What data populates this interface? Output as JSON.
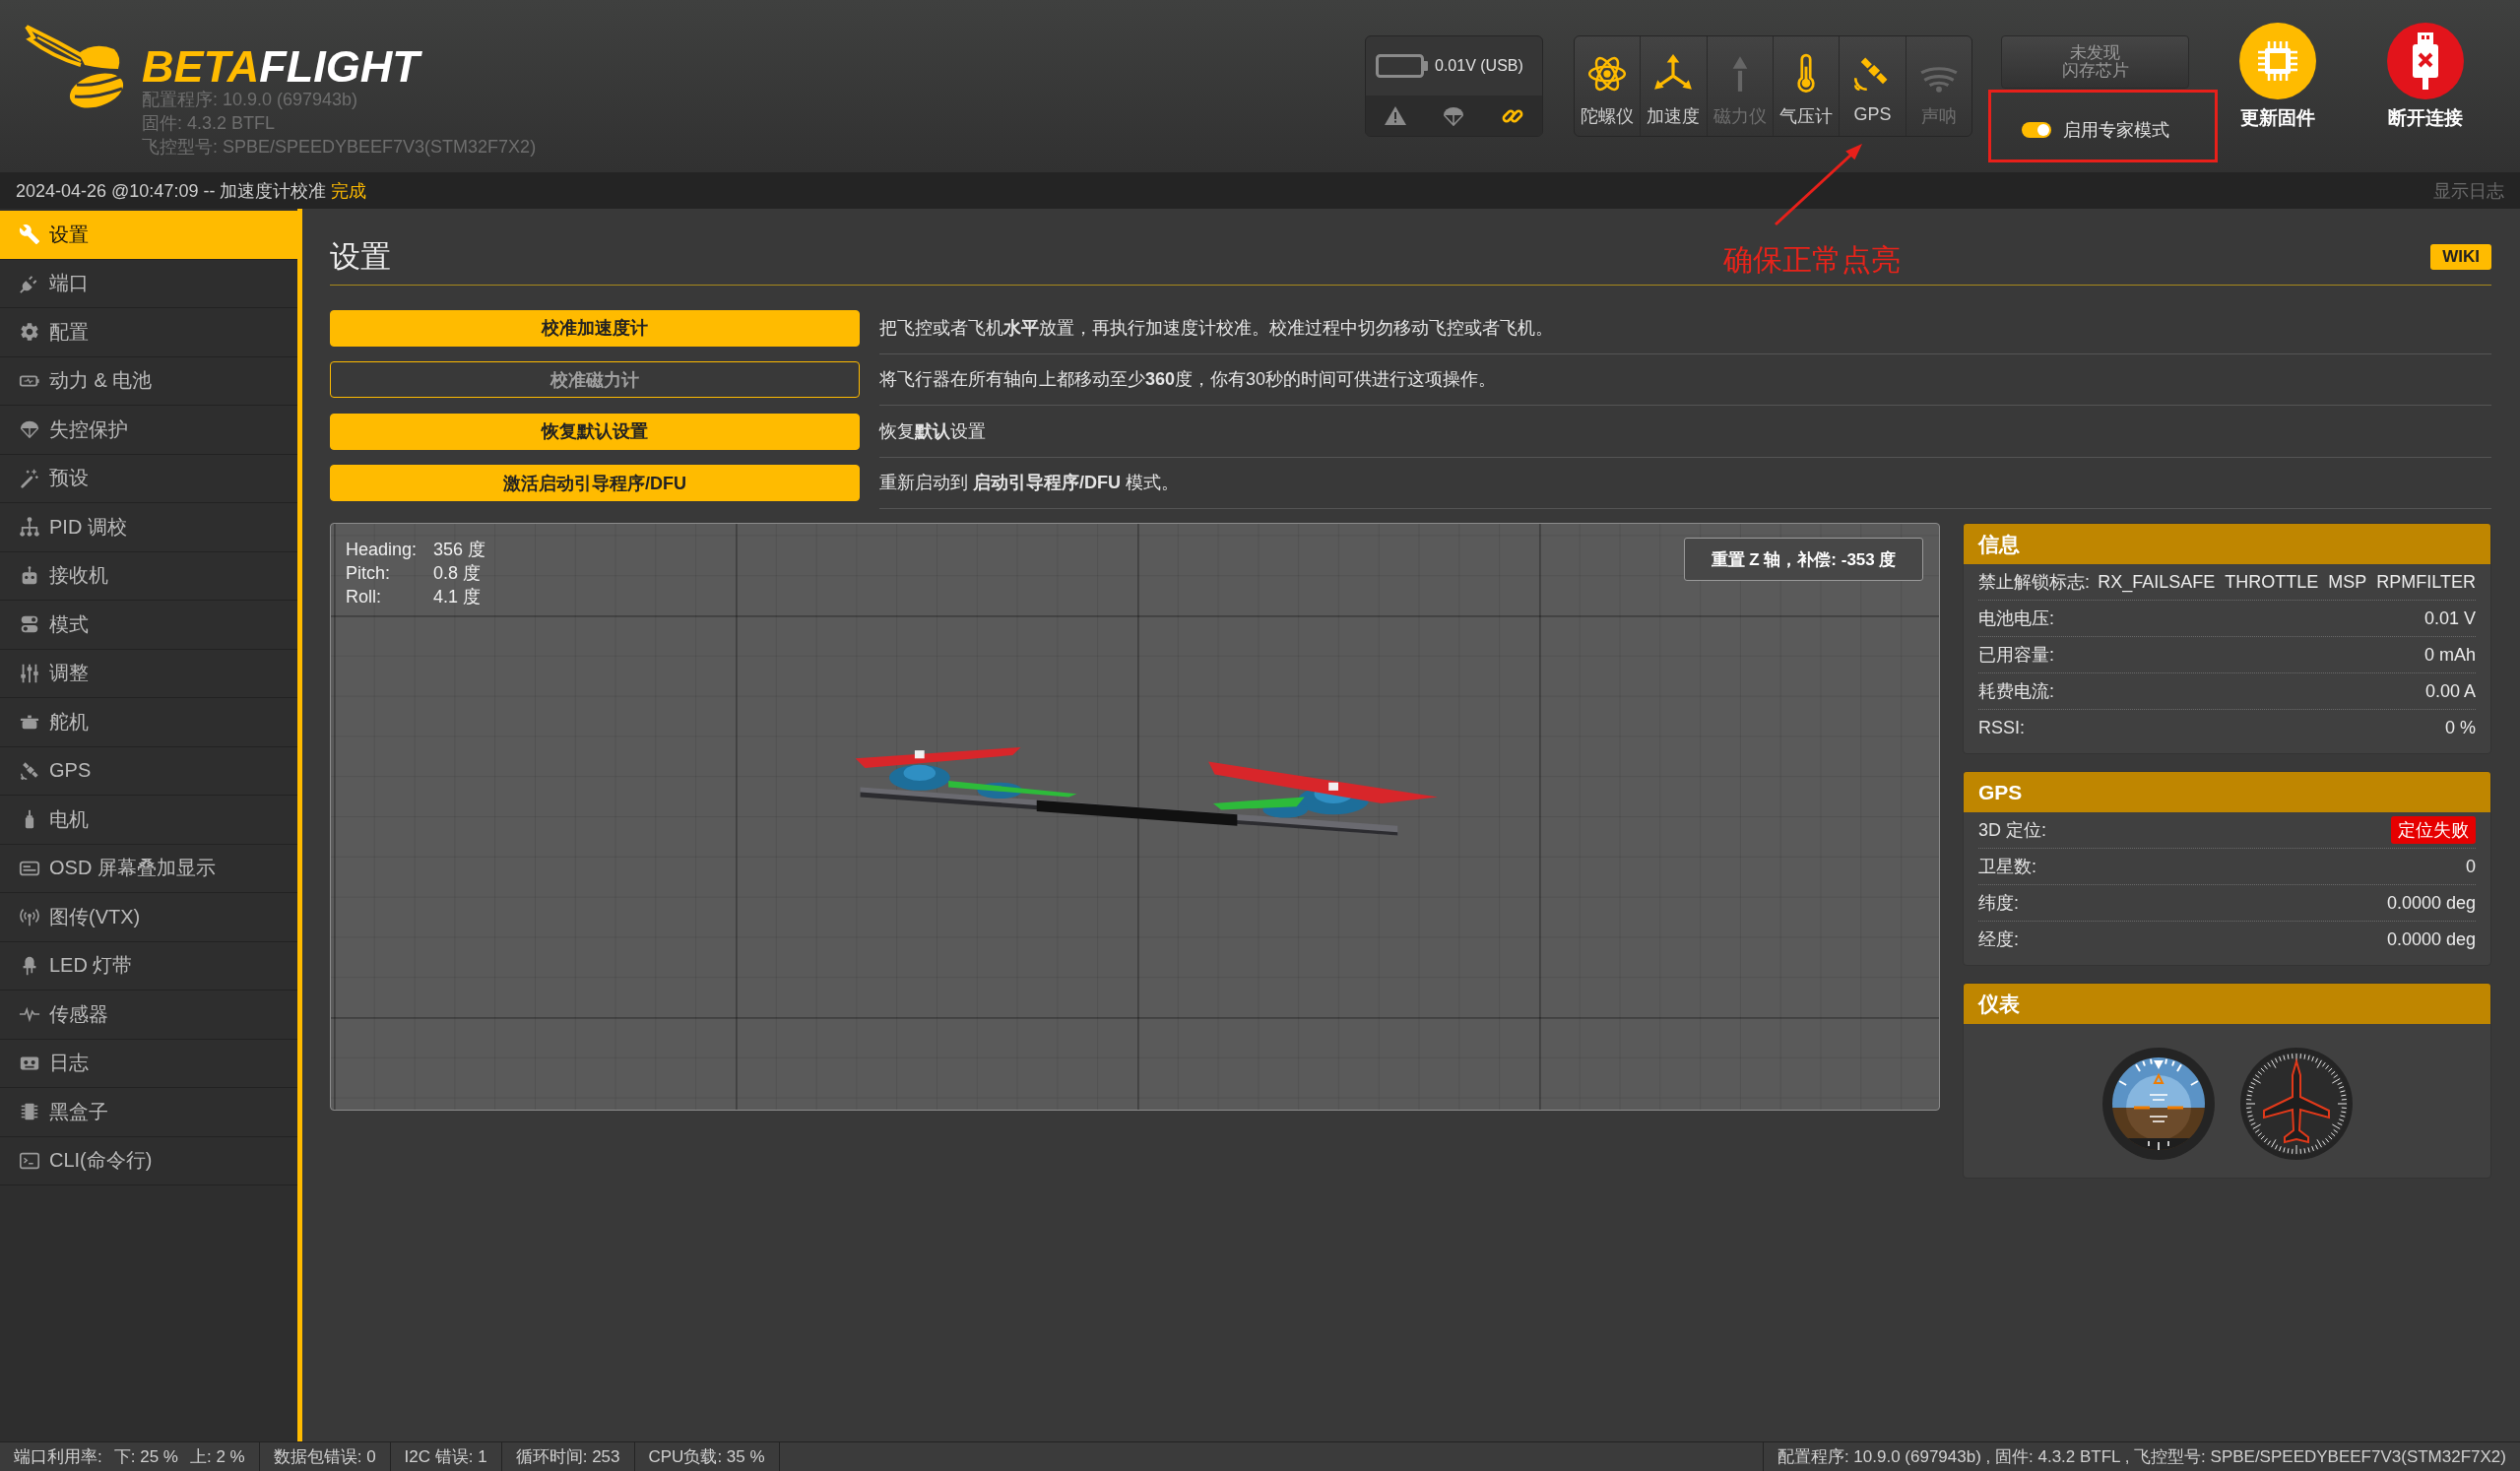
{
  "header": {
    "logo_text": [
      "BETA",
      "FLIGHT"
    ],
    "version_lines": [
      "配置程序: 10.9.0 (697943b)",
      "固件: 4.3.2 BTFL",
      "飞控型号: SPBE/SPEEDYBEEF7V3(STM32F7X2)"
    ],
    "battery": {
      "reading": "0.01V (USB)",
      "status_icons": [
        {
          "active": false
        },
        {
          "active": false
        },
        {
          "active": true
        }
      ]
    },
    "sensors": [
      {
        "label": "陀螺仪",
        "active": true
      },
      {
        "label": "加速度",
        "active": true
      },
      {
        "label": "磁力仪",
        "active": false
      },
      {
        "label": "气压计",
        "active": true
      },
      {
        "label": "GPS",
        "active": true
      },
      {
        "label": "声呐",
        "active": false
      }
    ],
    "flash_status": [
      "未发现",
      "闪存芯片"
    ],
    "expert_mode": {
      "label": "启用专家模式",
      "on": true
    },
    "buttons": [
      {
        "kind": "update",
        "label": "更新固件"
      },
      {
        "kind": "disconnect",
        "label": "断开连接"
      }
    ]
  },
  "log_bar": {
    "message": "2024-04-26 @10:47:09 -- 加速度计校准",
    "status": "完成",
    "show_log": "显示日志"
  },
  "sidebar": {
    "items": [
      {
        "label": "设置",
        "selected": true
      },
      {
        "label": "端口",
        "selected": false
      },
      {
        "label": "配置",
        "selected": false
      },
      {
        "label": "动力 & 电池",
        "selected": false
      },
      {
        "label": "失控保护",
        "selected": false
      },
      {
        "label": "预设",
        "selected": false
      },
      {
        "label": "PID 调校",
        "selected": false
      },
      {
        "label": "接收机",
        "selected": false
      },
      {
        "label": "模式",
        "selected": false
      },
      {
        "label": "调整",
        "selected": false
      },
      {
        "label": "舵机",
        "selected": false
      },
      {
        "label": "GPS",
        "selected": false
      },
      {
        "label": "电机",
        "selected": false
      },
      {
        "label": "OSD 屏幕叠加显示",
        "selected": false
      },
      {
        "label": "图传(VTX)",
        "selected": false
      },
      {
        "label": "LED 灯带",
        "selected": false
      },
      {
        "label": "传感器",
        "selected": false
      },
      {
        "label": "日志",
        "selected": false
      },
      {
        "label": "黑盒子",
        "selected": false
      },
      {
        "label": "CLI(命令行)",
        "selected": false
      }
    ]
  },
  "page": {
    "title": "设置",
    "wiki": "WIKI",
    "actions": [
      {
        "button": "校准加速度计",
        "disabled": false,
        "description": "把飞控或者飞机**水平**放置，再执行加速度计校准。校准过程中切勿移动飞控或者飞机。"
      },
      {
        "button": "校准磁力计",
        "disabled": true,
        "description": "将飞行器在所有轴向上都移动至少**360**度，你有30秒的时间可供进行这项操作。"
      },
      {
        "button": "恢复默认设置",
        "disabled": false,
        "description": "恢复**默认**设置"
      },
      {
        "button": "激活启动引导程序/DFU",
        "disabled": false,
        "description": "重新启动到 **启动引导程序/DFU** 模式。"
      }
    ],
    "model_view": {
      "readouts": [
        {
          "label": "Heading:",
          "value": "356 度"
        },
        {
          "label": "Pitch:",
          "value": "0.8 度"
        },
        {
          "label": "Roll:",
          "value": "4.1 度"
        }
      ],
      "reset_button": "重置 Z 轴，补偿: -353 度"
    },
    "panels": [
      {
        "kind": "rows",
        "title": "信息",
        "rows": [
          {
            "kind": "flags",
            "label": "禁止解锁标志:",
            "flags": [
              "RX_FAILSAFE",
              "THROTTLE",
              "MSP",
              "RPMFILTER"
            ]
          },
          {
            "kind": "value",
            "label": "电池电压:",
            "value": "0.01 V"
          },
          {
            "kind": "value",
            "label": "已用容量:",
            "value": "0 mAh"
          },
          {
            "kind": "value",
            "label": "耗费电流:",
            "value": "0.00 A"
          },
          {
            "kind": "value",
            "label": "RSSI:",
            "value": "0 %"
          }
        ]
      },
      {
        "kind": "rows",
        "title": "GPS",
        "rows": [
          {
            "kind": "status",
            "label": "3D 定位:",
            "value": "定位失败",
            "ok": false
          },
          {
            "kind": "value",
            "label": "卫星数:",
            "value": "0"
          },
          {
            "kind": "value",
            "label": "纬度:",
            "value": "0.0000 deg"
          },
          {
            "kind": "value",
            "label": "经度:",
            "value": "0.0000 deg"
          }
        ]
      },
      {
        "kind": "gauges",
        "title": "仪表"
      }
    ]
  },
  "annotation": {
    "text": "确保正常点亮"
  },
  "status_bar": {
    "groups": [
      [
        "端口利用率:",
        "下: 25 %",
        "上: 2 %"
      ],
      [
        "数据包错误: 0"
      ],
      [
        "I2C 错误: 1"
      ],
      [
        "循环时间: 253"
      ],
      [
        "CPU负载: 35 %"
      ]
    ],
    "version": "配置程序: 10.9.0 (697943b) , 固件: 4.3.2 BTFL , 飞控型号: SPBE/SPEEDYBEEF7V3(STM32F7X2)"
  }
}
